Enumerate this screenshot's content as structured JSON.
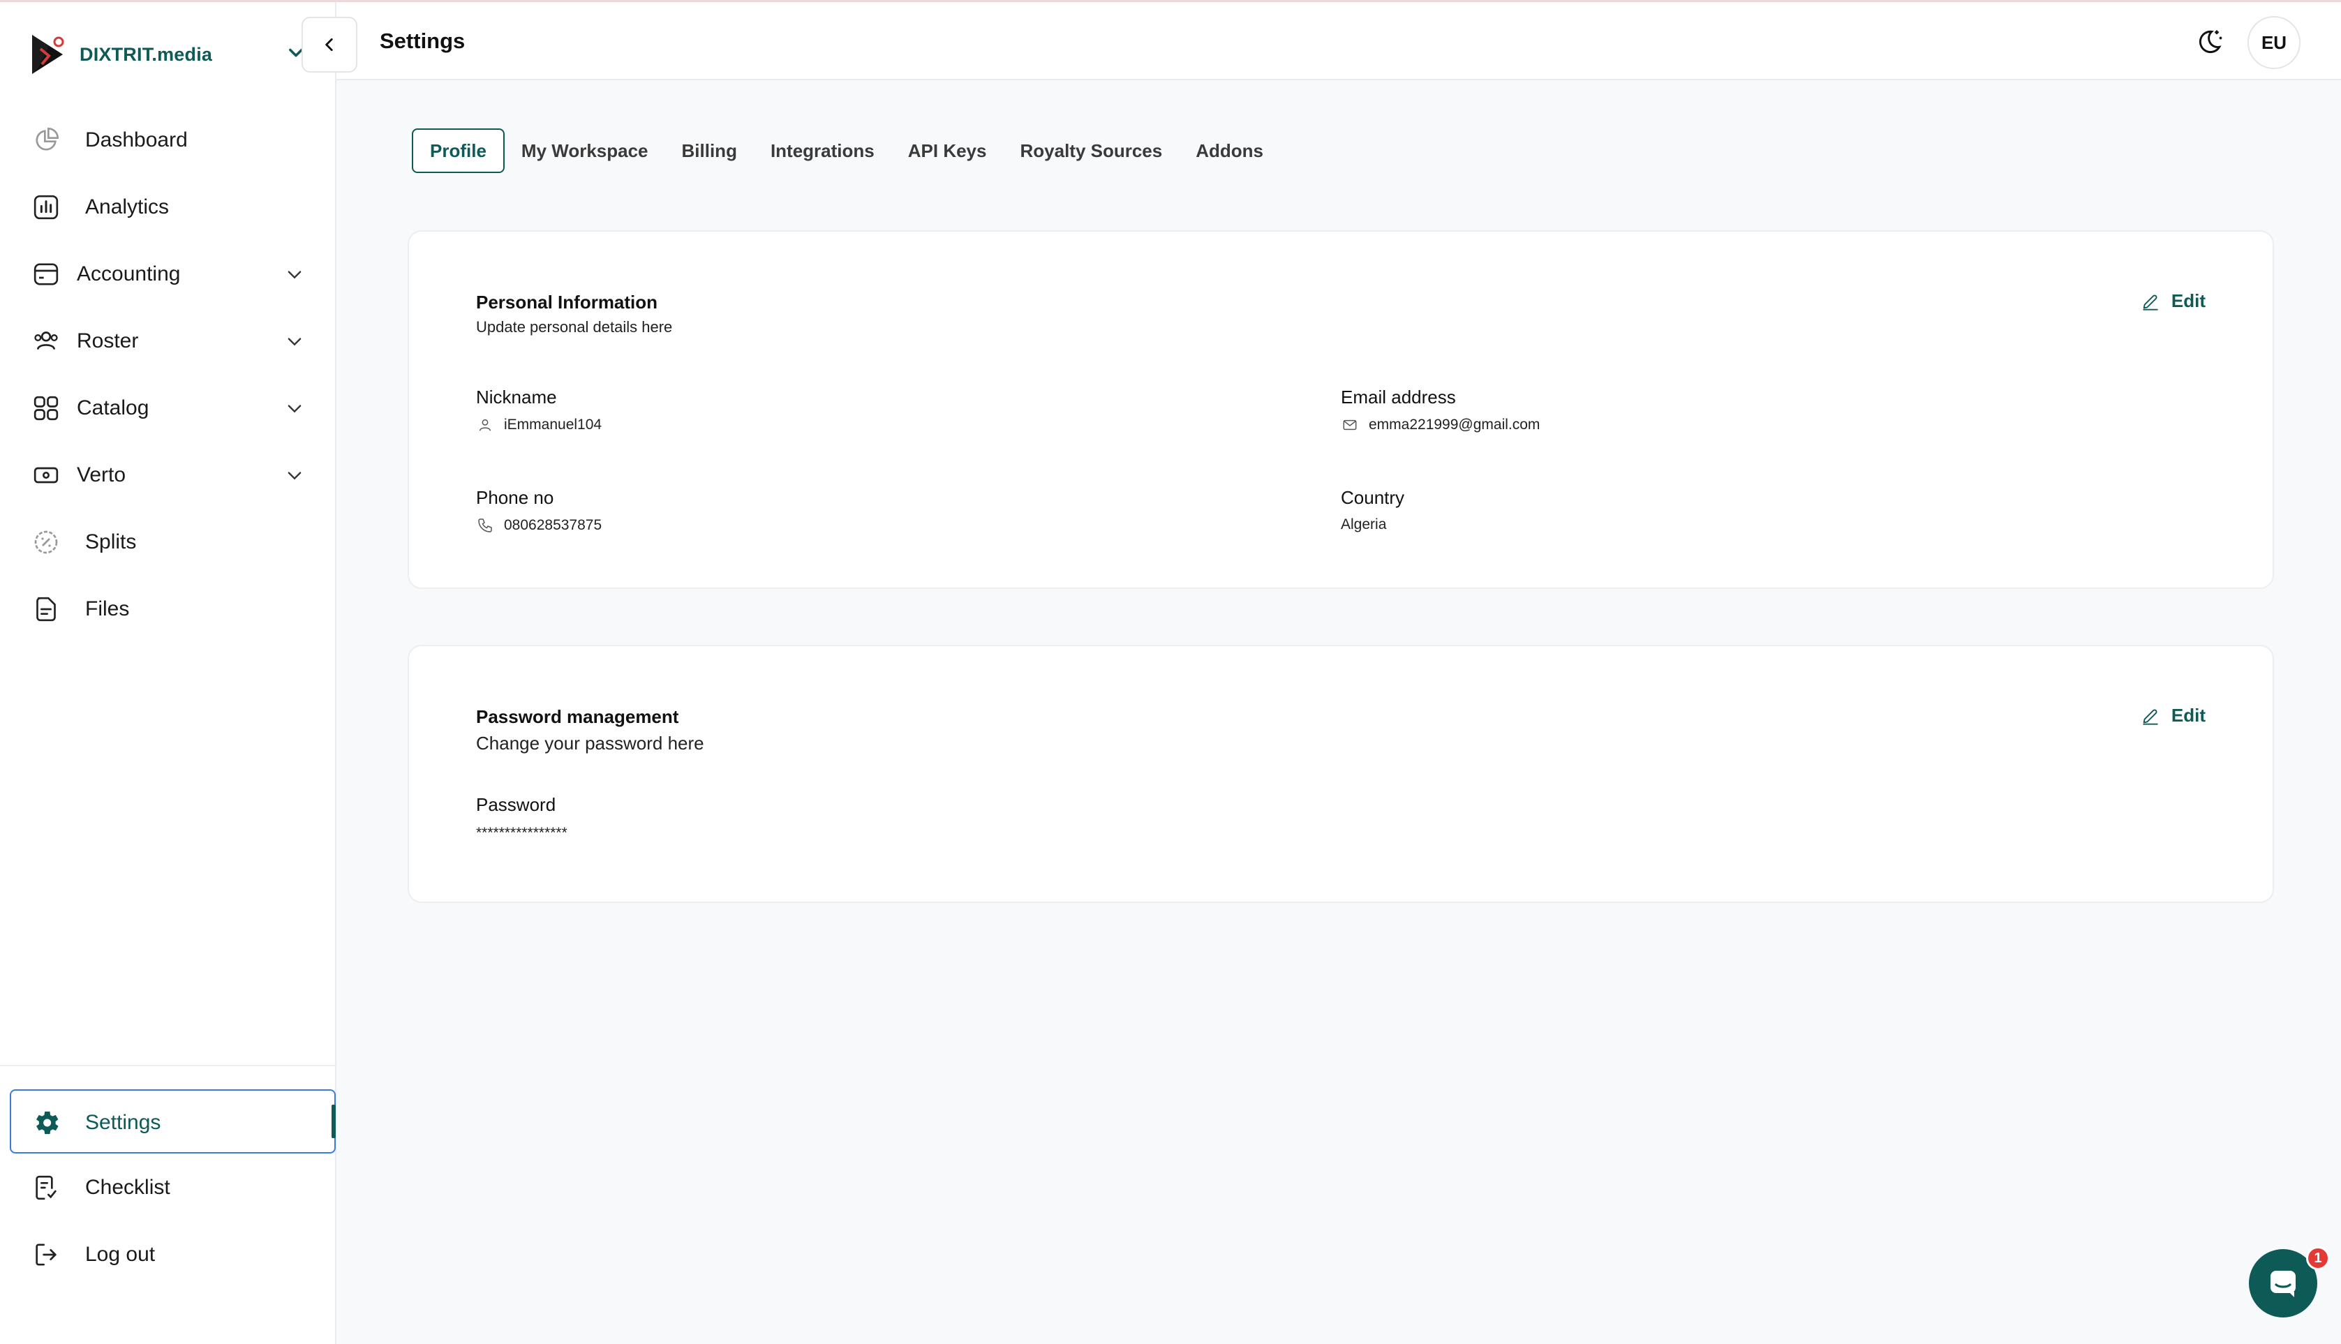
{
  "brand": {
    "name": "DIXTRIT.media"
  },
  "header": {
    "title": "Settings",
    "avatar_initials": "EU"
  },
  "sidebar": {
    "items": [
      {
        "label": "Dashboard"
      },
      {
        "label": "Analytics"
      },
      {
        "label": "Accounting"
      },
      {
        "label": "Roster"
      },
      {
        "label": "Catalog"
      },
      {
        "label": "Verto"
      },
      {
        "label": "Splits"
      },
      {
        "label": "Files"
      }
    ],
    "bottom": [
      {
        "label": "Settings"
      },
      {
        "label": "Checklist"
      },
      {
        "label": "Log out"
      }
    ]
  },
  "tabs": [
    "Profile",
    "My Workspace",
    "Billing",
    "Integrations",
    "API Keys",
    "Royalty Sources",
    "Addons"
  ],
  "personal": {
    "title": "Personal Information",
    "subtitle": "Update personal details here",
    "edit_label": "Edit",
    "nickname_label": "Nickname",
    "nickname_value": "iEmmanuel104",
    "email_label": "Email address",
    "email_value": "emma221999@gmail.com",
    "phone_label": "Phone no",
    "phone_value": "080628537875",
    "country_label": "Country",
    "country_value": "Algeria"
  },
  "password": {
    "title": "Password management",
    "subtitle": "Change your password here",
    "edit_label": "Edit",
    "label": "Password",
    "value": "****************"
  },
  "chat": {
    "badge_count": "1"
  },
  "colors": {
    "accent": "#0e5a57",
    "focus": "#3b7be0",
    "badge": "#e53935"
  }
}
